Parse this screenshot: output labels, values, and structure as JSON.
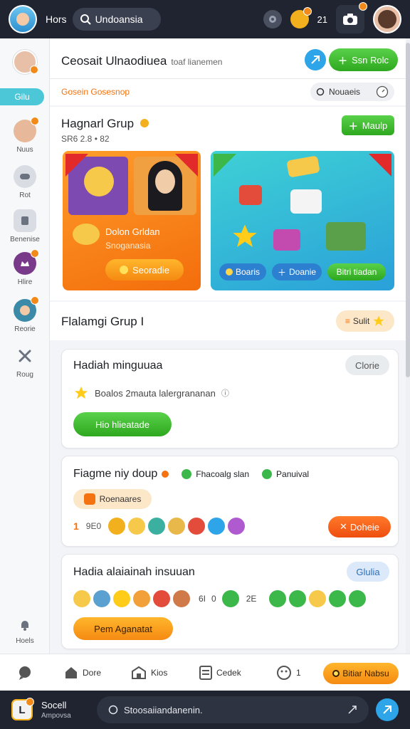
{
  "topbar": {
    "label": "Hors",
    "search_value": "Undoansia",
    "coins": "21"
  },
  "sidebar": {
    "active_label": "Gilu",
    "items": [
      {
        "label": "Nuus"
      },
      {
        "label": "Rot"
      },
      {
        "label": "Benenise"
      },
      {
        "label": "Hlire"
      },
      {
        "label": "Reorie"
      },
      {
        "label": "Roug"
      },
      {
        "label": "Hoels"
      }
    ]
  },
  "channel": {
    "title": "Ceosait Ulnaodiuea",
    "subtitle": "toaf lianemen",
    "action_label": "Ssn Rolc",
    "orange_tag": "Gosein Gosesnop",
    "toggle_label": "Nouaeis"
  },
  "group": {
    "title": "Hagnarl Grup",
    "meta": "SR6 2.8 • 82",
    "button_label": "Maulp",
    "card1": {
      "headline": "Dolon Grldan",
      "sub": "Snoganasia",
      "button": "Seoradie"
    },
    "card2": {
      "buttons": [
        "Boaris",
        "Doanie",
        "Bitri tiadan"
      ]
    }
  },
  "section": {
    "title": "Flalamgi Grup I",
    "badge": "Sulit"
  },
  "box1": {
    "title": "Hadiah minguuaa",
    "tag": "Clorie",
    "desc": "Boalos 2mauta lalergrananan",
    "button": "Hio hlieatade"
  },
  "box2": {
    "title": "Fiagme niy doup",
    "check1": "Fhacoalg slan",
    "check2": "Panuival",
    "chip": "Roenaares",
    "count_left": "1",
    "count_mid": "9E0",
    "button": "Doheie"
  },
  "box3": {
    "title": "Hadia alaiainah insuuan",
    "tag": "Glulia",
    "count_a": "6I",
    "count_b": "0",
    "count_c": "2E",
    "button": "Pem Aganatat"
  },
  "bottomnav": {
    "home": "Dore",
    "kios": "Kios",
    "ceder": "Cedek",
    "counter": "1",
    "cta": "Bitiar Nabsu"
  },
  "footer": {
    "brand": "Socell",
    "brand_sub": "Ampovsa",
    "input_placeholder": "Stoosaiiandanenin."
  },
  "colors": {
    "accent_green": "#2ea81f",
    "accent_orange": "#f47310",
    "accent_blue": "#2ea5e8",
    "topbar_bg": "#1f2430"
  }
}
